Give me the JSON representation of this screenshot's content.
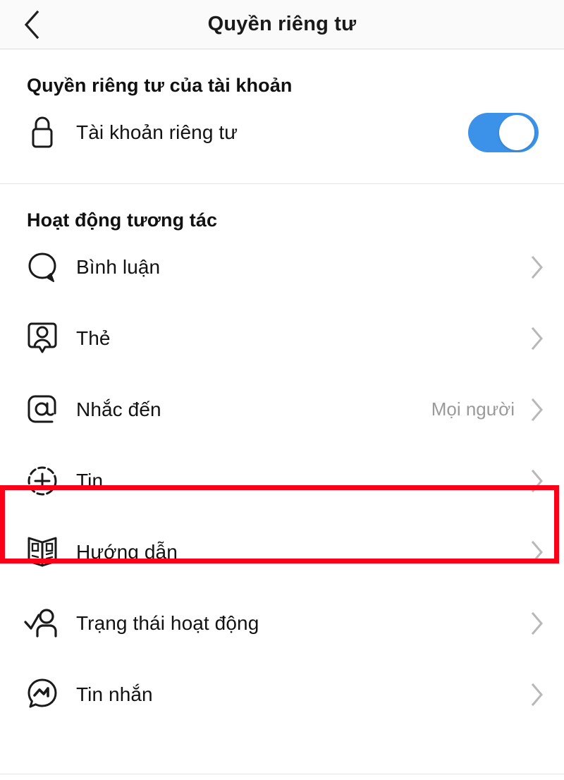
{
  "header": {
    "title": "Quyền riêng tư",
    "back_icon": "chevron-left-icon"
  },
  "sections": [
    {
      "id": "account-privacy",
      "title": "Quyền riêng tư của tài khoản",
      "rows": [
        {
          "id": "private-account",
          "label": "Tài khoản riêng tư",
          "icon": "lock-icon",
          "control": "toggle",
          "toggle_on": true,
          "value": ""
        }
      ]
    },
    {
      "id": "interactions",
      "title": "Hoạt động tương tác",
      "rows": [
        {
          "id": "comments",
          "label": "Bình luận",
          "icon": "comment-bubble-icon",
          "control": "chevron",
          "value": ""
        },
        {
          "id": "tags",
          "label": "Thẻ",
          "icon": "tag-person-icon",
          "control": "chevron",
          "value": ""
        },
        {
          "id": "mentions",
          "label": "Nhắc đến",
          "icon": "at-mention-icon",
          "control": "chevron",
          "value": "Mọi người"
        },
        {
          "id": "story",
          "label": "Tin",
          "icon": "story-plus-icon",
          "control": "chevron",
          "value": "",
          "highlighted": true
        },
        {
          "id": "guides",
          "label": "Hướng dẫn",
          "icon": "guide-book-icon",
          "control": "chevron",
          "value": ""
        },
        {
          "id": "activity-status",
          "label": "Trạng thái hoạt động",
          "icon": "activity-person-check-icon",
          "control": "chevron",
          "value": ""
        },
        {
          "id": "messages",
          "label": "Tin nhắn",
          "icon": "messenger-icon",
          "control": "chevron",
          "value": ""
        }
      ]
    }
  ],
  "colors": {
    "accent_toggle": "#3b92e8",
    "highlight_border": "#fb0017",
    "header_bg": "#fafafa",
    "text_primary": "#121212",
    "text_secondary": "#9a9a9a",
    "divider": "#e4e4e4"
  }
}
